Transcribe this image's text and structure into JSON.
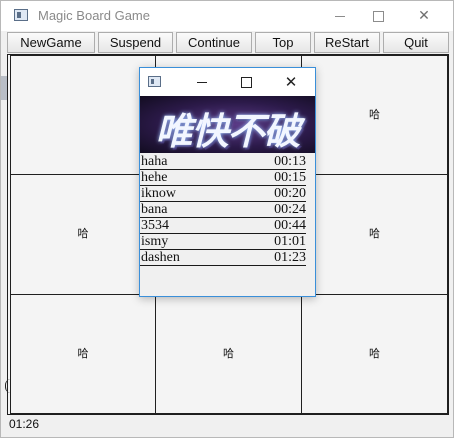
{
  "window": {
    "title": "Magic Board Game"
  },
  "toolbar": {
    "buttons": [
      "NewGame",
      "Suspend",
      "Continue",
      "Top",
      "ReStart",
      "Quit"
    ]
  },
  "board": {
    "cells": [
      "",
      "",
      "哈",
      "哈",
      "",
      "哈",
      "哈",
      "哈",
      "哈"
    ]
  },
  "status": {
    "timer": "01:26"
  },
  "dialog": {
    "banner_text": "唯快不破",
    "scores": [
      {
        "name": "haha",
        "time": "00:13"
      },
      {
        "name": "hehe",
        "time": "00:15"
      },
      {
        "name": "iknow",
        "time": "00:20"
      },
      {
        "name": "bana",
        "time": "00:24"
      },
      {
        "name": "3534",
        "time": "00:44"
      },
      {
        "name": "ismy",
        "time": "01:01"
      },
      {
        "name": "dashen",
        "time": "01:23"
      }
    ]
  },
  "icons": [
    "app-window-icon",
    "minimize-icon",
    "maximize-icon",
    "close-icon"
  ],
  "colors": {
    "dialog_border": "#3a8fd9",
    "banner_bg": "#2c1a4a"
  }
}
